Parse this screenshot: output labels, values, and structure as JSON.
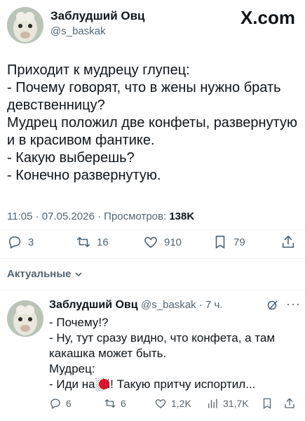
{
  "header": {
    "display_name": "Заблудший Овц",
    "handle": "@s_baskak",
    "brand_text": "X.com"
  },
  "tweet": {
    "lines": [
      "Приходит к мудрецу глупец:",
      "- Почему говорят, что в жены нужно брать",
      "девственницу?",
      "Мудрец положил две конфеты, развернутую",
      "и в красивом фантике.",
      "- Какую выберешь?",
      "- Конечно развернутую."
    ],
    "time_date": "11:05 · 07.05.2026 · Просмотров:",
    "views": "138K",
    "counts": {
      "replies": "3",
      "reposts": "16",
      "likes": "910",
      "bookmarks": "79"
    }
  },
  "sort_label": "Актуальные",
  "reply": {
    "display_name": "Заблудший Овц",
    "handle_time": "@s_baskak · 7 ч.",
    "lines": [
      "- Почему!?",
      "- Ну, тут сразу видно, что конфета, а там",
      "какашка может быть.",
      "Мудрец:",
      "- Иди на░й! Такую притчу испортил..."
    ],
    "counts": {
      "replies": "6",
      "reposts": "6",
      "likes": "1,2K",
      "views": "31,7K"
    }
  },
  "colors": {
    "text": "#0f1419",
    "muted": "#536471",
    "redaction": "#e0102a"
  }
}
